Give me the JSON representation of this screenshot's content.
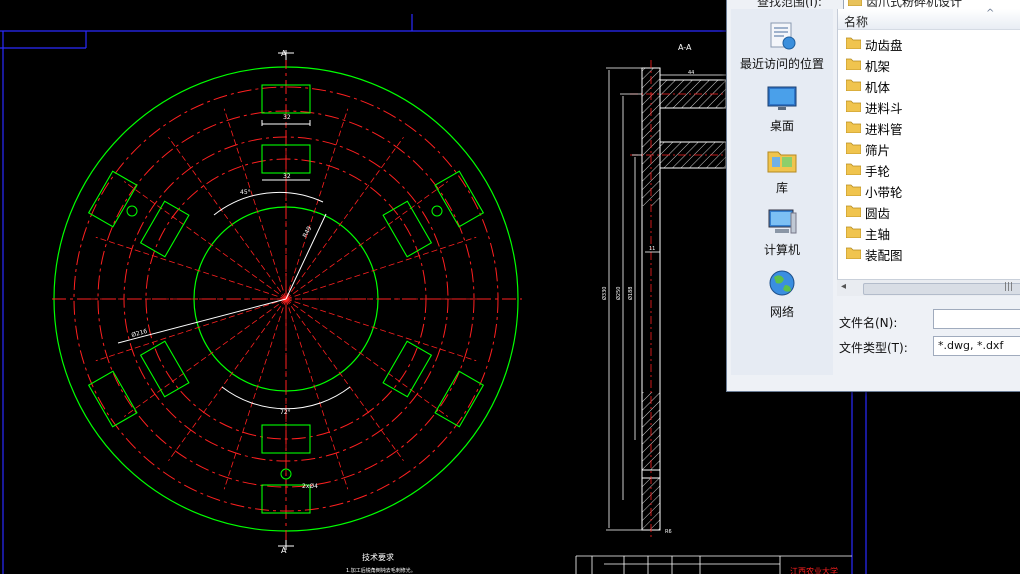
{
  "drawing": {
    "section_label": "A-A",
    "section_marker": "A",
    "dims": {
      "slot_width_top": "32",
      "slot_width_inner": "32",
      "angle_45": "45°",
      "angle_72": "72°",
      "radius_r": "R49",
      "dia_outer": "Ø216",
      "hole_dia": "2xØ4",
      "side_width_top": "44",
      "side_thick": "11",
      "side_dia_1": "Ø330",
      "side_dia_2": "Ø250",
      "side_dia_3": "Ø188",
      "side_bottom": "R6"
    },
    "notes_title": "技术要求",
    "notes_line1": "1.加工后锐角倒钝去毛刺修光。",
    "title_block_text": "江西农业大学"
  },
  "dialog": {
    "look_in_label": "查找范围(I):",
    "look_in_folder": "齿爪式粉碎机设计",
    "places": [
      {
        "label": "最近访问的位置",
        "icon": "recent-places-icon"
      },
      {
        "label": "桌面",
        "icon": "desktop-icon"
      },
      {
        "label": "库",
        "icon": "libraries-icon"
      },
      {
        "label": "计算机",
        "icon": "computer-icon"
      },
      {
        "label": "网络",
        "icon": "network-icon"
      }
    ],
    "column_name": "名称",
    "sort_glyph": "^",
    "files": [
      "动齿盘",
      "机架",
      "机体",
      "进料斗",
      "进料管",
      "筛片",
      "手轮",
      "小带轮",
      "圆齿",
      "主轴",
      "装配图"
    ],
    "scroll_left": "◂",
    "scroll_grip": "|||",
    "filename_label": "文件名(N):",
    "filename_value": "",
    "filetype_label": "文件类型(T):",
    "filetype_value": "*.dwg, *.dxf"
  },
  "colors": {
    "outline": "#00ff00",
    "centerline": "#ff2020",
    "dimension": "#ffffff",
    "frame": "#2a2aff",
    "hatch": "#ffffff",
    "background": "#000000"
  }
}
